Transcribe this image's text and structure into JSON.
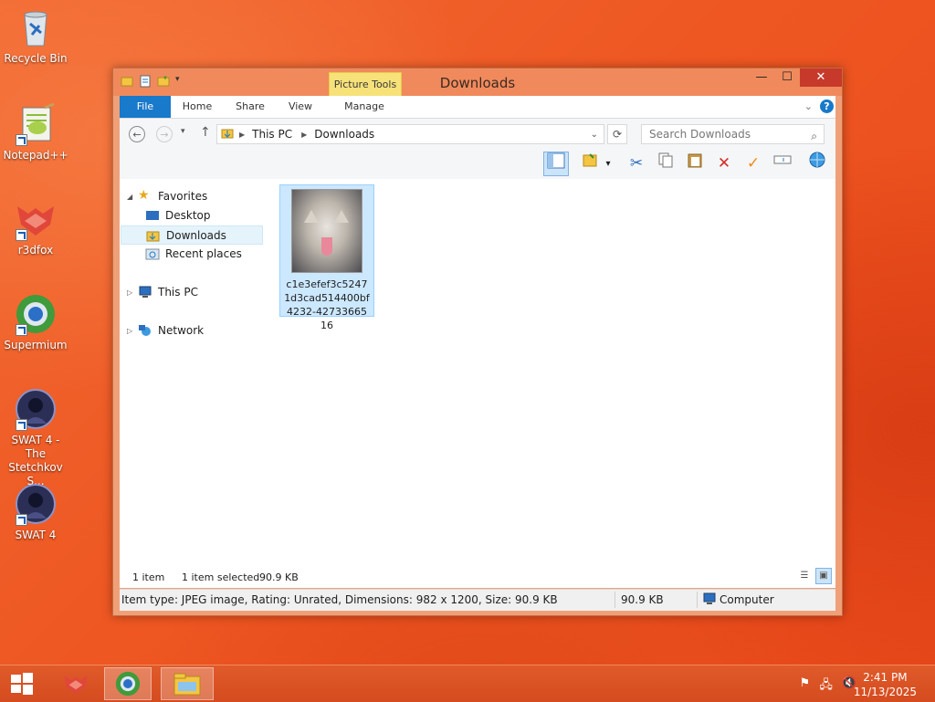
{
  "desktop": {
    "icons": [
      {
        "label": "Recycle Bin"
      },
      {
        "label": "Notepad++"
      },
      {
        "label": "r3dfox"
      },
      {
        "label": "Supermium"
      },
      {
        "label": "SWAT 4 - The Stetchkov S..."
      },
      {
        "label": "SWAT 4"
      }
    ]
  },
  "window": {
    "title": "Downloads",
    "context_tab_group": "Picture Tools",
    "ribbon_tabs": [
      "File",
      "Home",
      "Share",
      "View",
      "Manage"
    ],
    "address": {
      "crumbs": [
        "This PC",
        "Downloads"
      ]
    },
    "search_placeholder": "Search Downloads",
    "nav_pane": {
      "favorites": "Favorites",
      "desktop": "Desktop",
      "downloads": "Downloads",
      "recent": "Recent places",
      "this_pc": "This PC",
      "network": "Network"
    },
    "files": [
      {
        "name": "c1e3efef3c52471d3cad514400bf4232-4273366516",
        "selected": true
      }
    ],
    "status": {
      "item_count": "1 item",
      "selection": "1 item selected",
      "selection_size": "90.9 KB"
    },
    "details_bar": {
      "info": "Item type: JPEG image, Rating: Unrated, Dimensions: 982 x 1200, Size: 90.9 KB",
      "size": "90.9 KB",
      "location": "Computer"
    }
  },
  "taskbar": {
    "time": "2:41 PM",
    "date": "11/13/2025"
  },
  "colors": {
    "accent": "#1979ca",
    "titlebar": "#f08a5c",
    "close_button": "#c7392b",
    "selection": "#cce8ff"
  }
}
